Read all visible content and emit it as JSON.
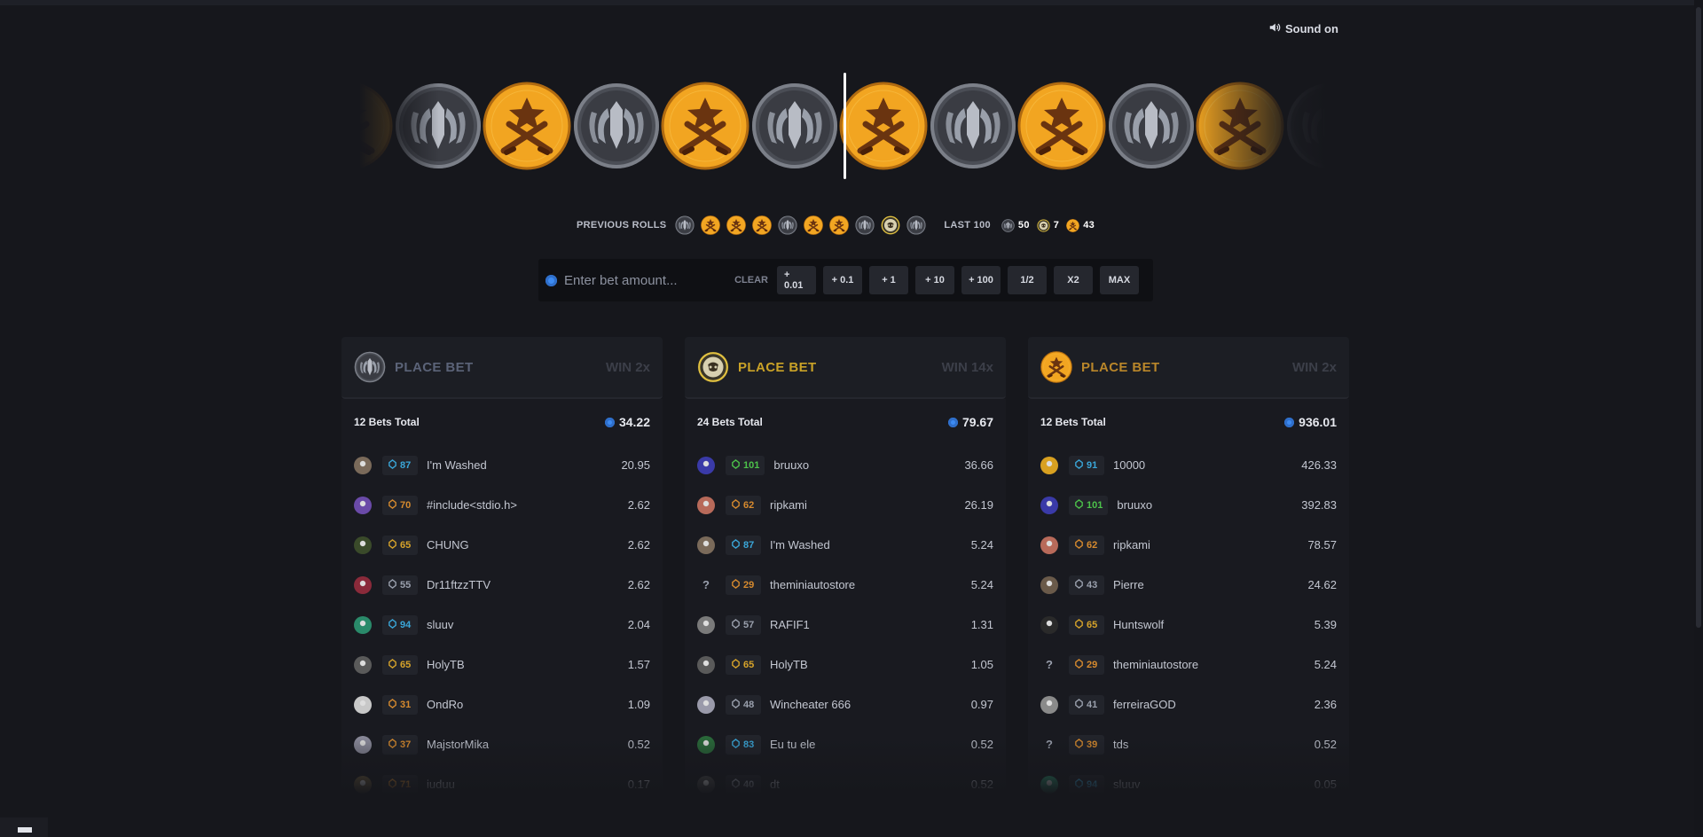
{
  "header": {
    "sound_label": "Sound on",
    "sound_icon": "speaker-icon"
  },
  "roller": {
    "coins": [
      "t",
      "ct",
      "t",
      "ct",
      "t",
      "ct",
      "t",
      "ct",
      "t",
      "ct",
      "t",
      "ct"
    ],
    "colors": {
      "t": "#f2a521",
      "ct": "#7b7f88",
      "bonus": "#e0c040"
    }
  },
  "previous_rolls": {
    "label": "PREVIOUS ROLLS",
    "rolls": [
      "ct",
      "t",
      "t",
      "t",
      "ct",
      "t",
      "t",
      "ct",
      "bonus",
      "ct"
    ],
    "last100_label": "LAST 100",
    "stats": [
      {
        "type": "ct",
        "count": "50"
      },
      {
        "type": "bonus",
        "count": "7"
      },
      {
        "type": "t",
        "count": "43"
      }
    ]
  },
  "bet": {
    "placeholder": "Enter bet amount...",
    "clear_label": "CLEAR",
    "buttons": [
      "+ 0.01",
      "+ 0.1",
      "+ 1",
      "+ 10",
      "+ 100",
      "1/2",
      "X2",
      "MAX"
    ]
  },
  "columns": [
    {
      "type": "ct",
      "title": "PLACE BET",
      "title_color": "#5b6378",
      "win": "WIN 2x",
      "bets_total": "12 Bets Total",
      "sum": "34.22",
      "rows": [
        {
          "level": "87",
          "lvl_color": "blue",
          "name": "I'm Washed",
          "amount": "20.95",
          "avatar": "#7a6a5a"
        },
        {
          "level": "70",
          "lvl_color": "orange",
          "name": "#include<stdio.h>",
          "amount": "2.62",
          "avatar": "#6a4aa8"
        },
        {
          "level": "65",
          "lvl_color": "yellow",
          "name": "CHUNG",
          "amount": "2.62",
          "avatar": "#3a4a2a"
        },
        {
          "level": "55",
          "lvl_color": "gray",
          "name": "Dr11ftzzTTV",
          "amount": "2.62",
          "avatar": "#8a2a3a"
        },
        {
          "level": "94",
          "lvl_color": "blue",
          "name": "sluuv",
          "amount": "2.04",
          "avatar": "#2a8a6a"
        },
        {
          "level": "65",
          "lvl_color": "yellow",
          "name": "HolyTB",
          "amount": "1.57",
          "avatar": "#5a5a5a"
        },
        {
          "level": "31",
          "lvl_color": "orange",
          "name": "OndRo",
          "amount": "1.09",
          "avatar": "#c8c8c8"
        },
        {
          "level": "37",
          "lvl_color": "orange",
          "name": "MajstorMika",
          "amount": "0.52",
          "avatar": "#8a8a9a"
        },
        {
          "level": "71",
          "lvl_color": "orange",
          "name": "iuduu",
          "amount": "0.17",
          "avatar": "#6a5a3a"
        }
      ]
    },
    {
      "type": "bonus",
      "title": "PLACE BET",
      "title_color": "#c9a227",
      "win": "WIN 14x",
      "bets_total": "24 Bets Total",
      "sum": "79.67",
      "rows": [
        {
          "level": "101",
          "lvl_color": "green",
          "name": "bruuxo",
          "amount": "36.66",
          "avatar": "#3a3aa8"
        },
        {
          "level": "62",
          "lvl_color": "orange",
          "name": "ripkami",
          "amount": "26.19",
          "avatar": "#b86a5a"
        },
        {
          "level": "87",
          "lvl_color": "blue",
          "name": "I'm Washed",
          "amount": "5.24",
          "avatar": "#7a6a5a"
        },
        {
          "level": "29",
          "lvl_color": "orange",
          "name": "theminiautostore",
          "amount": "5.24",
          "avatar": "?"
        },
        {
          "level": "57",
          "lvl_color": "gray",
          "name": "RAFIF1",
          "amount": "1.31",
          "avatar": "#7a7a7a"
        },
        {
          "level": "65",
          "lvl_color": "yellow",
          "name": "HolyTB",
          "amount": "1.05",
          "avatar": "#5a5a5a"
        },
        {
          "level": "48",
          "lvl_color": "gray",
          "name": "Wincheater 666",
          "amount": "0.97",
          "avatar": "#9a9aaa"
        },
        {
          "level": "83",
          "lvl_color": "blue",
          "name": "Eu tu ele",
          "amount": "0.52",
          "avatar": "#2a6a3a"
        },
        {
          "level": "40",
          "lvl_color": "gray",
          "name": "dt",
          "amount": "0.52",
          "avatar": "#4a4a4a"
        }
      ]
    },
    {
      "type": "t",
      "title": "PLACE BET",
      "title_color": "#b9862a",
      "win": "WIN 2x",
      "bets_total": "12 Bets Total",
      "sum": "936.01",
      "rows": [
        {
          "level": "91",
          "lvl_color": "blue",
          "name": "10000",
          "amount": "426.33",
          "avatar": "#d8a020"
        },
        {
          "level": "101",
          "lvl_color": "green",
          "name": "bruuxo",
          "amount": "392.83",
          "avatar": "#3a3aa8"
        },
        {
          "level": "62",
          "lvl_color": "orange",
          "name": "ripkami",
          "amount": "78.57",
          "avatar": "#b86a5a"
        },
        {
          "level": "43",
          "lvl_color": "gray",
          "name": "Pierre",
          "amount": "24.62",
          "avatar": "#6a5a4a"
        },
        {
          "level": "65",
          "lvl_color": "yellow",
          "name": "Huntswolf",
          "amount": "5.39",
          "avatar": "#2a2a2a"
        },
        {
          "level": "29",
          "lvl_color": "orange",
          "name": "theminiautostore",
          "amount": "5.24",
          "avatar": "?"
        },
        {
          "level": "41",
          "lvl_color": "gray",
          "name": "ferreiraGOD",
          "amount": "2.36",
          "avatar": "#8a8a8a"
        },
        {
          "level": "39",
          "lvl_color": "orange",
          "name": "tds",
          "amount": "0.52",
          "avatar": "?"
        },
        {
          "level": "94",
          "lvl_color": "blue",
          "name": "sluuv",
          "amount": "0.05",
          "avatar": "#2a8a6a"
        }
      ]
    }
  ]
}
